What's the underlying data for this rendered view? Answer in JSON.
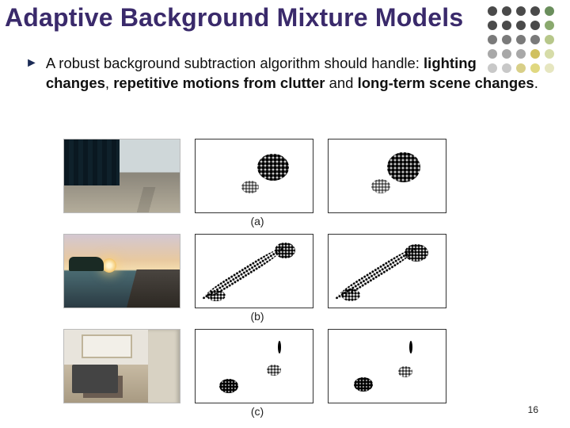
{
  "title": "Adaptive Background Mixture Models",
  "bullet": {
    "marker": "►",
    "pre": "A robust background subtraction algorithm should handle: ",
    "b1": "lighting changes",
    "sep1": ", ",
    "b2": "repetitive motions from clutter",
    "mid": " and ",
    "b3": "long-term scene changes",
    "end": "."
  },
  "figure_labels": {
    "a": "(a)",
    "b": "(b)",
    "c": "(c)"
  },
  "page_number": "16",
  "dot_colors": [
    "#4a4a4a",
    "#4a4a4a",
    "#4a4a4a",
    "#4a4a4a",
    "#6a8e5c",
    "#4a4a4a",
    "#4a4a4a",
    "#4a4a4a",
    "#4a4a4a",
    "#8aa96e",
    "#7a7a7a",
    "#7a7a7a",
    "#7a7a7a",
    "#7a7a7a",
    "#b7c78a",
    "#a8a8a8",
    "#a8a8a8",
    "#a8a8a8",
    "#d0c060",
    "#d6dca8",
    "#c8c8c8",
    "#c8c8c8",
    "#d8cf88",
    "#e0d880",
    "#e6e6c0"
  ]
}
